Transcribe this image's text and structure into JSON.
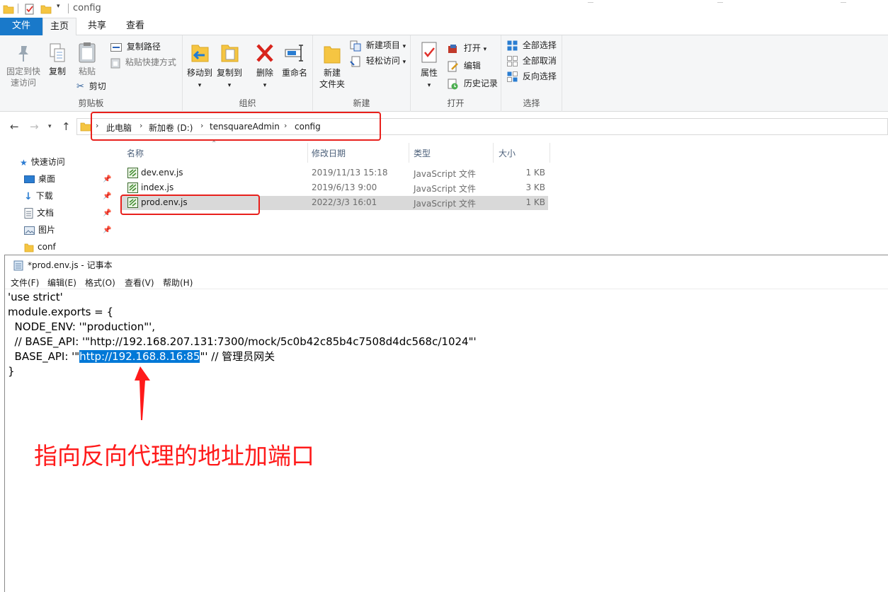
{
  "explorer": {
    "title": "config",
    "ribbon_tabs": [
      "文件",
      "主页",
      "共享",
      "查看"
    ],
    "ribbon": {
      "clipboard": {
        "group": "剪贴板",
        "pin_quick": "固定到快\n速访问",
        "pin_quick_l1": "固定到快",
        "pin_quick_l2": "速访问",
        "copy": "复制",
        "paste": "粘贴",
        "copy_path": "复制路径",
        "paste_shortcut": "粘贴快捷方式",
        "cut": "剪切"
      },
      "organize": {
        "group": "组织",
        "move_to": "移动到",
        "copy_to": "复制到",
        "delete": "删除",
        "rename": "重命名"
      },
      "new": {
        "group": "新建",
        "new_folder_l1": "新建",
        "new_folder_l2": "文件夹",
        "new_item": "新建项目",
        "easy_access": "轻松访问"
      },
      "open": {
        "group": "打开",
        "properties": "属性",
        "open": "打开",
        "edit": "编辑",
        "history": "历史记录"
      },
      "select": {
        "group": "选择",
        "select_all": "全部选择",
        "select_none": "全部取消",
        "invert": "反向选择"
      }
    },
    "breadcrumb": [
      "此电脑",
      "新加卷 (D:)",
      "tensquareAdmin",
      "config"
    ],
    "nav": [
      {
        "label": "快速访问",
        "icon": "star-icon"
      },
      {
        "label": "桌面",
        "icon": "desktop-icon"
      },
      {
        "label": "下载",
        "icon": "download-icon"
      },
      {
        "label": "文档",
        "icon": "document-icon"
      },
      {
        "label": "图片",
        "icon": "picture-icon"
      },
      {
        "label": "conf",
        "icon": "folder-icon"
      }
    ],
    "columns": {
      "name": "名称",
      "date": "修改日期",
      "type": "类型",
      "size": "大小"
    },
    "files": [
      {
        "name": "dev.env.js",
        "date": "2019/11/13 15:18",
        "type": "JavaScript 文件",
        "size": "1 KB"
      },
      {
        "name": "index.js",
        "date": "2019/6/13 9:00",
        "type": "JavaScript 文件",
        "size": "3 KB"
      },
      {
        "name": "prod.env.js",
        "date": "2022/3/3 16:01",
        "type": "JavaScript 文件",
        "size": "1 KB"
      }
    ]
  },
  "notepad": {
    "title": "*prod.env.js - 记事本",
    "menu": [
      "文件(F)",
      "编辑(E)",
      "格式(O)",
      "查看(V)",
      "帮助(H)"
    ],
    "lines": {
      "l1": "'use strict'",
      "l2": "module.exports = {",
      "l3": "  NODE_ENV: '\"production\"',",
      "l4": "  // BASE_API: '\"http://192.168.207.131:7300/mock/5c0b42c85b4c7508d4dc568c/1024\"'",
      "l5_pre": "  BASE_API: '\"",
      "l5_sel": "http://192.168.8.16:85",
      "l5_post": "\"' // 管理员网关",
      "l6": "}"
    }
  },
  "annotation": "指向反向代理的地址加端口",
  "colors": {
    "accent": "#1979ca",
    "annotation": "#ff1a1a",
    "selection": "#0078d7"
  }
}
